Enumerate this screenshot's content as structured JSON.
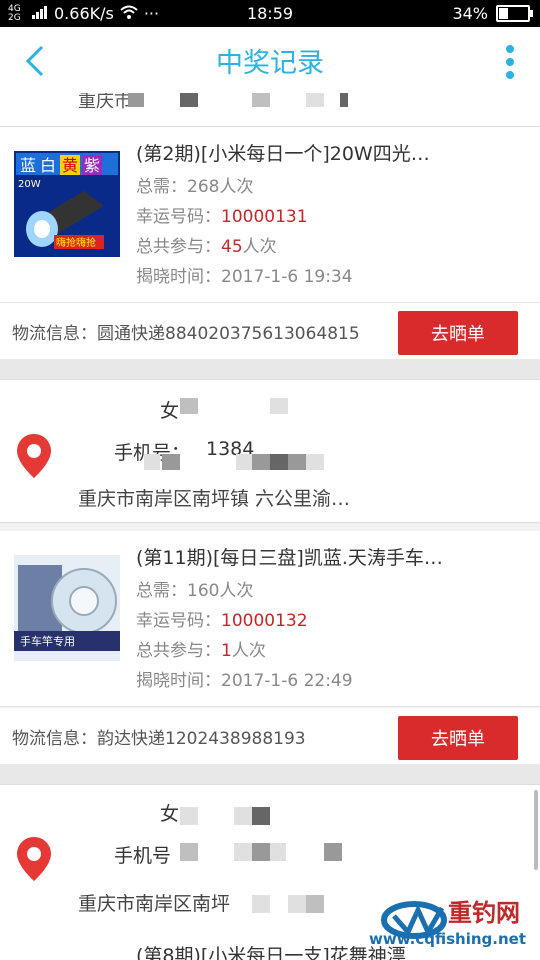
{
  "status": {
    "network": "4G 2G",
    "speed": "0.66K/s",
    "dots": "···",
    "time": "18:59",
    "battery": "34%",
    "battery_level": 0.34
  },
  "header": {
    "title": "中奖记录"
  },
  "top_fragment": {
    "address": "重庆市"
  },
  "prizes": [
    {
      "name": "(第2期)[小米每日一个]20W四光…",
      "need_label": "总需：",
      "need_value": "268人次",
      "lucky_label": "幸运号码：",
      "lucky_value": "10000131",
      "join_label": "总共参与：",
      "join_count": "45",
      "join_unit": "人次",
      "time_label": "揭晓时间：",
      "time_value": "2017-1-6 19:34",
      "logistics": "物流信息：圆通快递884020375613064815",
      "button": "去晒单",
      "thumb_text": [
        "蓝",
        "白",
        "黄",
        "紫",
        "20W",
        "嗨抢嗨抢"
      ]
    },
    {
      "name": "(第11期)[每日三盘]凯蓝.天涛手车…",
      "need_label": "总需：",
      "need_value": "160人次",
      "lucky_label": "幸运号码：",
      "lucky_value": "10000132",
      "join_label": "总共参与：",
      "join_count": "1",
      "join_unit": "人次",
      "time_label": "揭晓时间：",
      "time_value": "2017-1-6 22:49",
      "logistics": "物流信息：韵达快递1202438988193",
      "button": "去晒单",
      "thumb_text": [
        "手车竿专用"
      ]
    }
  ],
  "address_cards": [
    {
      "name": "女",
      "phone_label": "手机号：",
      "phone_partial": "1384",
      "address": "重庆市南岸区南坪镇 六公里渝…"
    },
    {
      "name": "女",
      "phone_label": "手机号",
      "address": "重庆市南岸区南坪"
    }
  ],
  "bottom_fragment": {
    "text": "(第8期)[小米每日一支]花舞神漂"
  },
  "watermark": {
    "name": "重钓网",
    "url": "www.cqfishing.net"
  },
  "colors": {
    "accent": "#2ab2e4",
    "button": "#d92b2b",
    "highlight": "#c0282a"
  }
}
